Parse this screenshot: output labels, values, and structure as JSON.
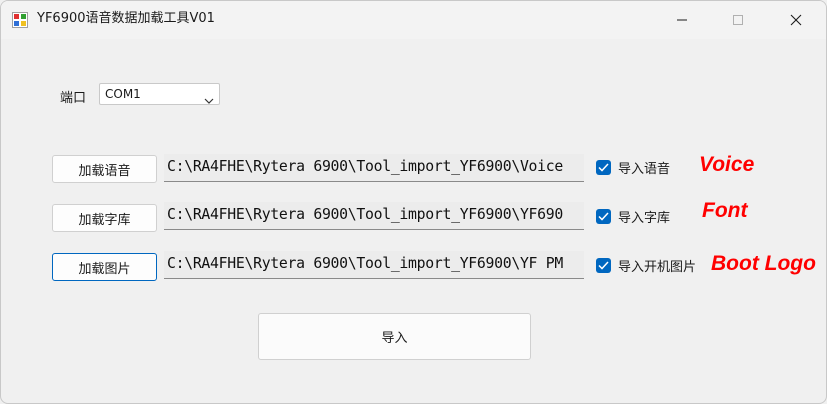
{
  "window": {
    "title": "YF6900语音数据加载工具V01"
  },
  "port": {
    "label": "端口",
    "selected": "COM1"
  },
  "rows": [
    {
      "button_label": "加载语音",
      "path": "C:\\RA4FHE\\Rytera 6900\\Tool_import_YF6900\\Voice",
      "checkbox_label": "导入语音",
      "checked": true,
      "annotation": "Voice"
    },
    {
      "button_label": "加载字库",
      "path": "C:\\RA4FHE\\Rytera 6900\\Tool_import_YF6900\\YF690",
      "checkbox_label": "导入字库",
      "checked": true,
      "annotation": "Font"
    },
    {
      "button_label": "加载图片",
      "path": "C:\\RA4FHE\\Rytera 6900\\Tool_import_YF6900\\YF PM",
      "checkbox_label": "导入开机图片",
      "checked": true,
      "annotation": "Boot Logo"
    }
  ],
  "import_button": {
    "label": "导入"
  },
  "colors": {
    "accent": "#0067c0",
    "annotation": "#ff0000",
    "background": "#f0f0f0"
  },
  "icons": {
    "app": "app-icon",
    "minimize": "minimize-icon",
    "maximize": "maximize-icon",
    "close": "close-icon",
    "dropdown": "chevron-down-icon",
    "check": "checkmark-icon"
  }
}
